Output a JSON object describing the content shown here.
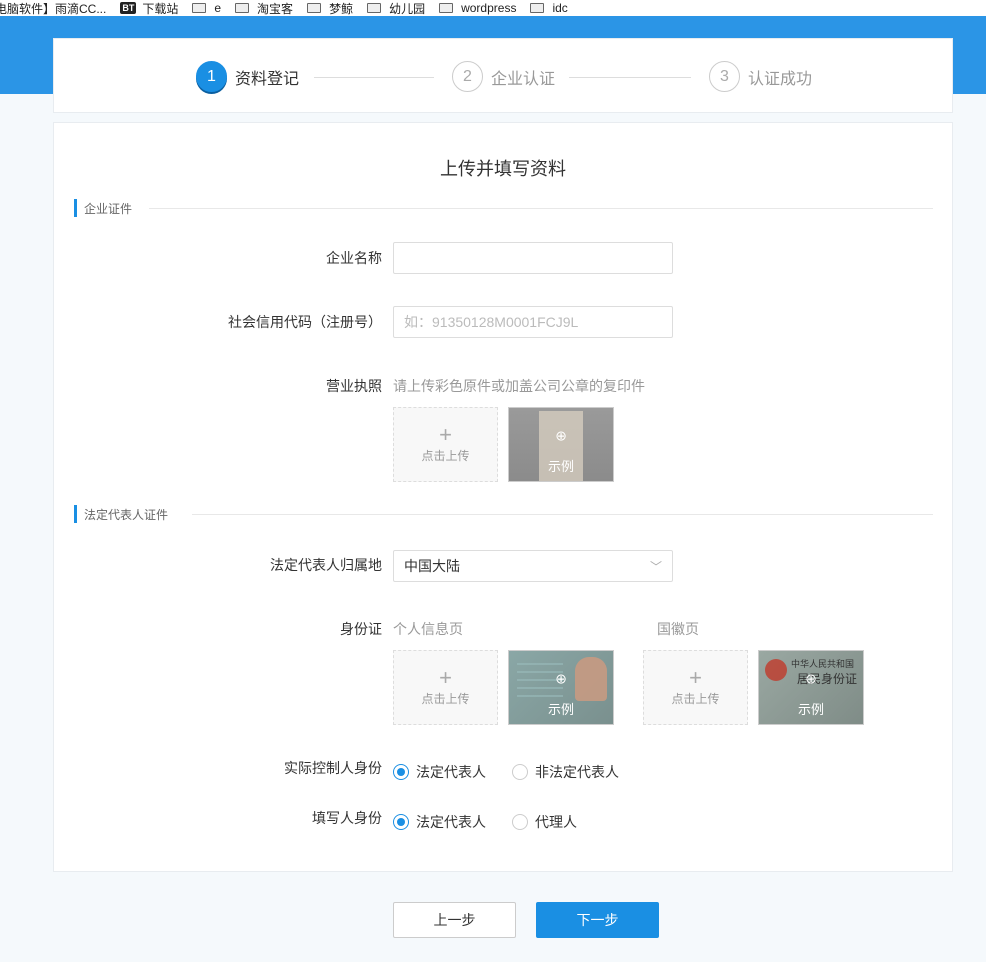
{
  "bookmarks": [
    {
      "label": "电脑软件】雨滴CC...",
      "icon": "none"
    },
    {
      "label": "下载站",
      "icon": "bt-icon"
    },
    {
      "label": "e",
      "icon": "folder-icon"
    },
    {
      "label": "淘宝客",
      "icon": "folder-icon"
    },
    {
      "label": "梦鲸",
      "icon": "folder-icon"
    },
    {
      "label": "幼儿园",
      "icon": "folder-icon"
    },
    {
      "label": "wordpress",
      "icon": "folder-icon"
    },
    {
      "label": "idc",
      "icon": "folder-icon"
    }
  ],
  "bt_badge": "BT",
  "steps": [
    {
      "num": "1",
      "label": "资料登记",
      "state": "active"
    },
    {
      "num": "2",
      "label": "企业认证",
      "state": "pending"
    },
    {
      "num": "3",
      "label": "认证成功",
      "state": "pending"
    }
  ],
  "page_title": "上传并填写资料",
  "section_company": "企业证件",
  "section_legal": "法定代表人证件",
  "company_name": {
    "label": "企业名称",
    "value": "",
    "placeholder": ""
  },
  "credit_code": {
    "label": "社会信用代码（注册号）",
    "value": "",
    "placeholder": "如：91350128M0001FCJ9L"
  },
  "license": {
    "label": "营业执照",
    "hint": "请上传彩色原件或加盖公司公章的复印件"
  },
  "upload_label": "点击上传",
  "upload_plus": "+",
  "sample_label": "示例",
  "zoom_glyph": "⊕",
  "region": {
    "label": "法定代表人归属地",
    "value": "中国大陆",
    "chevron": "﹀"
  },
  "id_card": {
    "label": "身份证",
    "front_hint": "个人信息页",
    "back_hint": "国徽页",
    "back_title_1": "中华人民共和国",
    "back_title_2": "居民身份证"
  },
  "controller": {
    "label": "实际控制人身份",
    "options": [
      "法定代表人",
      "非法定代表人"
    ],
    "selected": 0
  },
  "filler": {
    "label": "填写人身份",
    "options": [
      "法定代表人",
      "代理人"
    ],
    "selected": 0
  },
  "buttons": {
    "prev": "上一步",
    "next": "下一步"
  },
  "colors": {
    "primary": "#1a8fe3",
    "band": "#2b95e6"
  }
}
